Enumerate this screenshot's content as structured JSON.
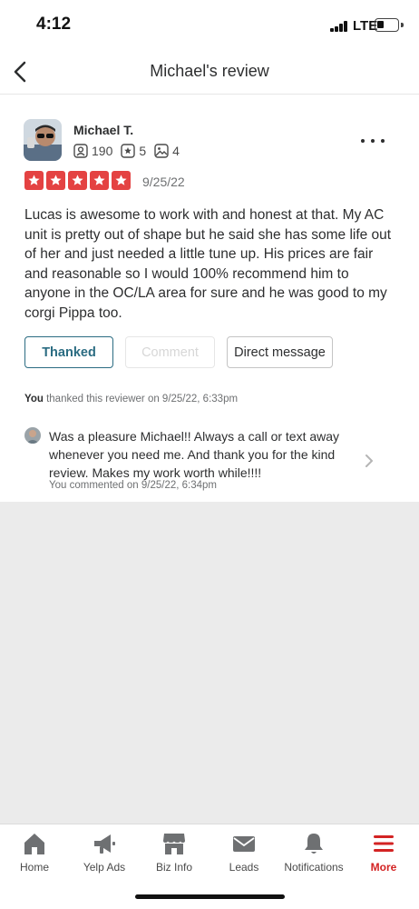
{
  "status_bar": {
    "time": "4:12",
    "carrier": "LTE",
    "battery_level": 0.35
  },
  "header": {
    "title": "Michael's review"
  },
  "review": {
    "user_name": "Michael T.",
    "stats": {
      "friends": "190",
      "reviews": "5",
      "photos": "4"
    },
    "rating": 5,
    "date": "9/25/22",
    "text": "Lucas is awesome to work with and honest at that. My AC unit is pretty out of shape but he said she has some life out of her and just needed a little tune up.  His prices are fair and reasonable so I would 100% recommend him to anyone in the OC/LA area for sure and he was good to my corgi Pippa too."
  },
  "actions": {
    "thanked_label": "Thanked",
    "comment_label": "Comment",
    "dm_label": "Direct message"
  },
  "thanked_note": {
    "actor": "You",
    "text": "thanked this reviewer on 9/25/22, 6:33pm"
  },
  "comment": {
    "text": "Was a pleasure Michael!! Always a call or text away whenever you need me. And thank you for the kind review. Makes my work worth while!!!!",
    "meta": "You commented on 9/25/22, 6:34pm"
  },
  "tabs": [
    {
      "label": "Home",
      "icon": "home-icon"
    },
    {
      "label": "Yelp Ads",
      "icon": "megaphone-icon"
    },
    {
      "label": "Biz Info",
      "icon": "storefront-icon"
    },
    {
      "label": "Leads",
      "icon": "envelope-icon"
    },
    {
      "label": "Notifications",
      "icon": "bell-icon"
    },
    {
      "label": "More",
      "icon": "menu-icon",
      "active": true
    }
  ],
  "colors": {
    "brand_red": "#d32323",
    "star_red": "#e44242",
    "thanked_teal": "#2b6c82"
  }
}
